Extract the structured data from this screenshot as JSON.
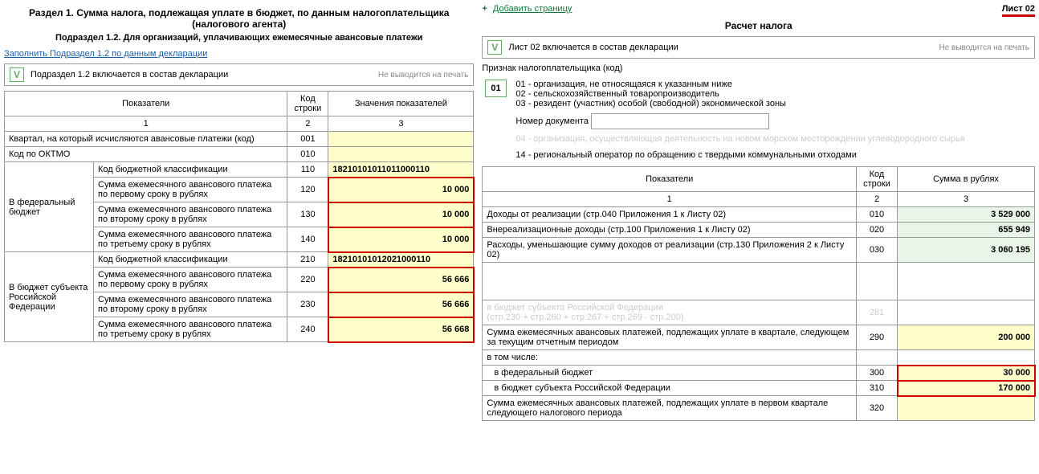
{
  "left": {
    "section_title": "Раздел 1. Сумма налога, подлежащая уплате в бюджет, по данным налогоплательщика (налогового агента)",
    "subsection_title": "Подраздел 1.2. Для организаций, уплачивающих ежемесячные авансовые платежи",
    "fill_link": "Заполнить Подраздел 1.2 по данным декларации",
    "include_text": "Подраздел 1.2 включается в состав декларации",
    "noprint": "Не выводится на печать",
    "headers": {
      "ind": "Показатели",
      "code": "Код строки",
      "val": "Значения показателей",
      "c1": "1",
      "c2": "2",
      "c3": "3"
    },
    "row_kvartal": "Квартал, на который исчисляются авансовые платежи (код)",
    "row_oktmo": "Код по ОКТМО",
    "fed_label": "В федеральный бюджет",
    "subj_label": "В бюджет субъекта Российской Федерации",
    "kbk_label": "Код бюджетной классификации",
    "r110": "18210101011011000110",
    "r120_label": "Сумма ежемесячного авансового платежа по первому сроку в рублях",
    "r130_label": "Сумма ежемесячного авансового платежа по второму сроку в рублях",
    "r140_label": "Сумма ежемесячного авансового платежа по третьему сроку в рублях",
    "r120": "10 000",
    "r130": "10 000",
    "r140": "10 000",
    "r210": "18210101012021000110",
    "r220": "56 666",
    "r230": "56 666",
    "r240": "56 668",
    "codes": {
      "c001": "001",
      "c010": "010",
      "c110": "110",
      "c120": "120",
      "c130": "130",
      "c140": "140",
      "c210": "210",
      "c220": "220",
      "c230": "230",
      "c240": "240"
    }
  },
  "right": {
    "add_page": "Добавить страницу",
    "sheet": "Лист 02",
    "calc_title": "Расчет налога",
    "include_text": "Лист 02 включается в состав декларации",
    "noprint": "Не выводится на печать",
    "taxpayer_sign": "Признак налогоплательщика (код)",
    "code01": "01",
    "tp01": "01 - организация, не относящаяся к указанным ниже",
    "tp02": "02 - сельскохозяйственный товаропроизводитель",
    "tp03": "03 - резидент (участник) особой (свободной) экономической зоны",
    "docnum_label": "Номер документа",
    "tp04_faded": "04 - организация, осуществляющая деятельность на новом морском месторождении углеводородного сырья",
    "tp14": "14 - региональный оператор по обращению с твердыми коммунальными отходами",
    "headers": {
      "ind": "Показатели",
      "code": "Код строки",
      "val": "Сумма в рублях",
      "c1": "1",
      "c2": "2",
      "c3": "3"
    },
    "r010_label": "Доходы от реализации (стр.040 Приложения 1 к Листу 02)",
    "r020_label": "Внереализационные доходы (стр.100 Приложения 1 к Листу 02)",
    "r030_label": "Расходы, уменьшающие сумму доходов от реализации (стр.130 Приложения 2 к Листу 02)",
    "r010": "3 529 000",
    "r020": "655 949",
    "r030": "3 060 195",
    "r281_label_a": "в бюджет субъекта Российской Федерации",
    "r281_label_b": "(стр.230 + стр.260 + стр.267 + стр.269 - стр.200)",
    "r290_label": "Сумма ежемесячных авансовых платежей, подлежащих уплате в квартале, следующем за текущим отчетным периодом",
    "r_incl": "в том числе:",
    "r300_label": "в федеральный бюджет",
    "r310_label": "в бюджет субъекта Российской Федерации",
    "r320_label": "Сумма ежемесячных авансовых платежей, подлежащих уплате в первом квартале следующего налогового периода",
    "r290": "200 000",
    "r300": "30 000",
    "r310": "170 000",
    "codes": {
      "c010": "010",
      "c020": "020",
      "c030": "030",
      "c281": "281",
      "c290": "290",
      "c300": "300",
      "c310": "310",
      "c320": "320"
    }
  }
}
